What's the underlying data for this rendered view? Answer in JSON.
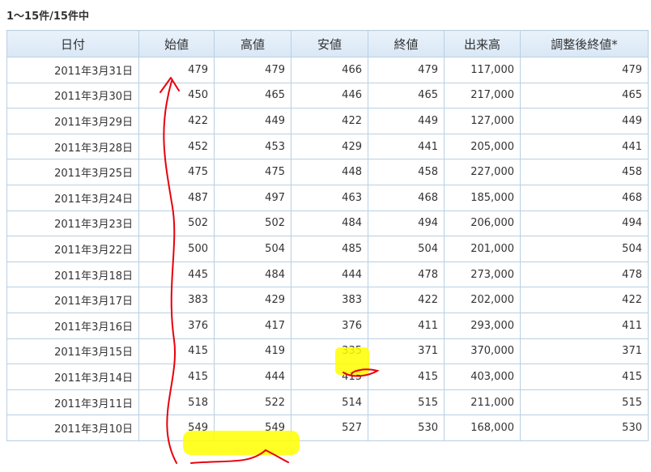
{
  "summary": "1〜15件/15件中",
  "columns": [
    "日付",
    "始値",
    "高値",
    "安値",
    "終値",
    "出来高",
    "調整後終値*"
  ],
  "rows": [
    [
      "2011年3月31日",
      "479",
      "479",
      "466",
      "479",
      "117,000",
      "479"
    ],
    [
      "2011年3月30日",
      "450",
      "465",
      "446",
      "465",
      "217,000",
      "465"
    ],
    [
      "2011年3月29日",
      "422",
      "449",
      "422",
      "449",
      "127,000",
      "449"
    ],
    [
      "2011年3月28日",
      "452",
      "453",
      "429",
      "441",
      "205,000",
      "441"
    ],
    [
      "2011年3月25日",
      "475",
      "475",
      "448",
      "458",
      "227,000",
      "458"
    ],
    [
      "2011年3月24日",
      "487",
      "497",
      "463",
      "468",
      "185,000",
      "468"
    ],
    [
      "2011年3月23日",
      "502",
      "502",
      "484",
      "494",
      "206,000",
      "494"
    ],
    [
      "2011年3月22日",
      "500",
      "504",
      "485",
      "504",
      "201,000",
      "504"
    ],
    [
      "2011年3月18日",
      "445",
      "484",
      "444",
      "478",
      "273,000",
      "478"
    ],
    [
      "2011年3月17日",
      "383",
      "429",
      "383",
      "422",
      "202,000",
      "422"
    ],
    [
      "2011年3月16日",
      "376",
      "417",
      "376",
      "411",
      "293,000",
      "411"
    ],
    [
      "2011年3月15日",
      "415",
      "419",
      "335",
      "371",
      "370,000",
      "371"
    ],
    [
      "2011年3月14日",
      "415",
      "444",
      "415",
      "415",
      "403,000",
      "415"
    ],
    [
      "2011年3月11日",
      "518",
      "522",
      "514",
      "515",
      "211,000",
      "515"
    ],
    [
      "2011年3月10日",
      "549",
      "549",
      "527",
      "530",
      "168,000",
      "530"
    ]
  ],
  "annotation_colors": {
    "highlight": "#ffff00",
    "ink": "#e8000b"
  }
}
